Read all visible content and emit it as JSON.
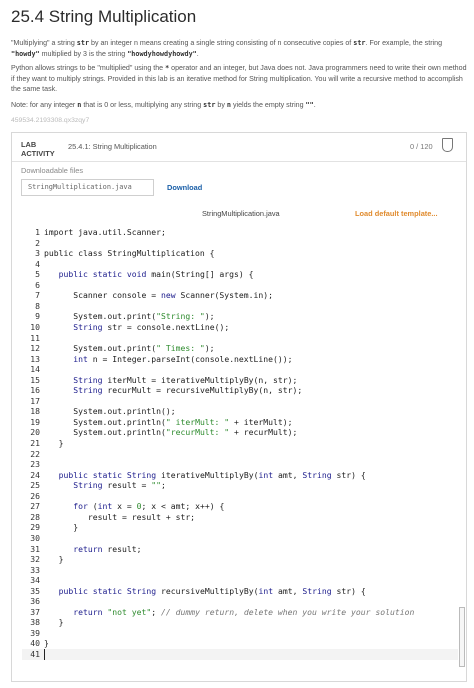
{
  "page": {
    "title": "25.4 String Multiplication",
    "p1_segments": [
      {
        "text": "\"Multiplying\" a string "
      },
      {
        "text": "str",
        "code": true
      },
      {
        "text": " by an integer n means creating a single string consisting of n consecutive copies of "
      },
      {
        "text": "str",
        "code": true
      },
      {
        "text": ". For example, the string "
      },
      {
        "text": "\"howdy\"",
        "code": true
      },
      {
        "text": " multiplied by 3 is the string "
      },
      {
        "text": "\"howdyhowdyhowdy\"",
        "code": true
      },
      {
        "text": "."
      }
    ],
    "p2_segments": [
      {
        "text": "Python allows strings to be \"multiplied\" using the "
      },
      {
        "text": "*",
        "code": true
      },
      {
        "text": " operator and an integer, but Java does not. Java programmers need to write their own method if they want to multiply strings. Provided in this lab is an iterative method for String multiplication. You will write a recursive method to accomplish the same task."
      }
    ],
    "p3_segments": [
      {
        "text": "Note: for any integer "
      },
      {
        "text": "n",
        "code": true
      },
      {
        "text": " that is 0 or less, multiplying any string "
      },
      {
        "text": "str",
        "code": true
      },
      {
        "text": " by "
      },
      {
        "text": "n",
        "code": true
      },
      {
        "text": " yields the empty string "
      },
      {
        "text": "\"\"",
        "code": true
      },
      {
        "text": "."
      }
    ],
    "hash_id": "459534.2193308.qx3zqy7"
  },
  "lab": {
    "tag_line1": "LAB",
    "tag_line2": "ACTIVITY",
    "name": "25.4.1: String Multiplication",
    "score": "0 / 120",
    "downloadable_label": "Downloadable files",
    "file_name": "StringMultiplication.java",
    "download_label": "Download",
    "editor_title": "StringMultiplication.java",
    "load_default_label": "Load default template..."
  },
  "editor": {
    "lines": [
      [
        {
          "t": "import java.util.Scanner;"
        }
      ],
      [],
      [
        {
          "t": "public class StringMultiplication {"
        }
      ],
      [],
      [
        {
          "t": "   "
        },
        {
          "t": "public static void",
          "c": "kw"
        },
        {
          "t": " main(String[] args) {"
        }
      ],
      [],
      [
        {
          "t": "      Scanner console = "
        },
        {
          "t": "new",
          "c": "kw"
        },
        {
          "t": " Scanner(System.in);"
        }
      ],
      [],
      [
        {
          "t": "      System.out.print("
        },
        {
          "t": "\"String: \"",
          "c": "str"
        },
        {
          "t": ");"
        }
      ],
      [
        {
          "t": "      "
        },
        {
          "t": "String",
          "c": "type"
        },
        {
          "t": " str = console.nextLine();"
        }
      ],
      [],
      [
        {
          "t": "      System.out.print("
        },
        {
          "t": "\" Times: \"",
          "c": "str"
        },
        {
          "t": ");"
        }
      ],
      [
        {
          "t": "      "
        },
        {
          "t": "int",
          "c": "kw"
        },
        {
          "t": " n = Integer.parseInt(console.nextLine());"
        }
      ],
      [],
      [
        {
          "t": "      "
        },
        {
          "t": "String",
          "c": "type"
        },
        {
          "t": " iterMult = iterativeMultiplyBy(n, str);"
        }
      ],
      [
        {
          "t": "      "
        },
        {
          "t": "String",
          "c": "type"
        },
        {
          "t": " recurMult = recursiveMultiplyBy(n, str);"
        }
      ],
      [],
      [
        {
          "t": "      System.out.println();"
        }
      ],
      [
        {
          "t": "      System.out.println("
        },
        {
          "t": "\" iterMult: \"",
          "c": "str"
        },
        {
          "t": " + iterMult);"
        }
      ],
      [
        {
          "t": "      System.out.println("
        },
        {
          "t": "\"recurMult: \"",
          "c": "str"
        },
        {
          "t": " + recurMult);"
        }
      ],
      [
        {
          "t": "   }"
        }
      ],
      [],
      [],
      [
        {
          "t": "   "
        },
        {
          "t": "public static",
          "c": "kw"
        },
        {
          "t": " "
        },
        {
          "t": "String",
          "c": "type"
        },
        {
          "t": " iterativeMultiplyBy("
        },
        {
          "t": "int",
          "c": "kw"
        },
        {
          "t": " amt, "
        },
        {
          "t": "String",
          "c": "type"
        },
        {
          "t": " str) {"
        }
      ],
      [
        {
          "t": "      "
        },
        {
          "t": "String",
          "c": "type"
        },
        {
          "t": " result = "
        },
        {
          "t": "\"\"",
          "c": "str"
        },
        {
          "t": ";"
        }
      ],
      [],
      [
        {
          "t": "      "
        },
        {
          "t": "for",
          "c": "kw"
        },
        {
          "t": " ("
        },
        {
          "t": "int",
          "c": "kw"
        },
        {
          "t": " x = "
        },
        {
          "t": "0",
          "c": "num"
        },
        {
          "t": "; x < amt; x++) {"
        }
      ],
      [
        {
          "t": "         result = result + str;"
        }
      ],
      [
        {
          "t": "      }"
        }
      ],
      [],
      [
        {
          "t": "      "
        },
        {
          "t": "return",
          "c": "kw"
        },
        {
          "t": " result;"
        }
      ],
      [
        {
          "t": "   }"
        }
      ],
      [],
      [],
      [
        {
          "t": "   "
        },
        {
          "t": "public static",
          "c": "kw"
        },
        {
          "t": " "
        },
        {
          "t": "String",
          "c": "type"
        },
        {
          "t": " recursiveMultiplyBy("
        },
        {
          "t": "int",
          "c": "kw"
        },
        {
          "t": " amt, "
        },
        {
          "t": "String",
          "c": "type"
        },
        {
          "t": " str) {"
        }
      ],
      [],
      [
        {
          "t": "      "
        },
        {
          "t": "return",
          "c": "kw"
        },
        {
          "t": " "
        },
        {
          "t": "\"not yet\"",
          "c": "str"
        },
        {
          "t": "; "
        },
        {
          "t": "// dummy return, delete when you write your solution",
          "c": "comment"
        }
      ],
      [
        {
          "t": "   }"
        }
      ],
      [],
      [
        {
          "t": "}"
        }
      ],
      []
    ],
    "active_line": 41
  },
  "colors": {
    "keyword": "#1c1c8c",
    "type": "#1c1c8c",
    "string": "#2e8b2e",
    "number": "#2e8b2e",
    "comment": "#777777",
    "link": "#1a5fa8",
    "load_default": "#e08b2e"
  }
}
